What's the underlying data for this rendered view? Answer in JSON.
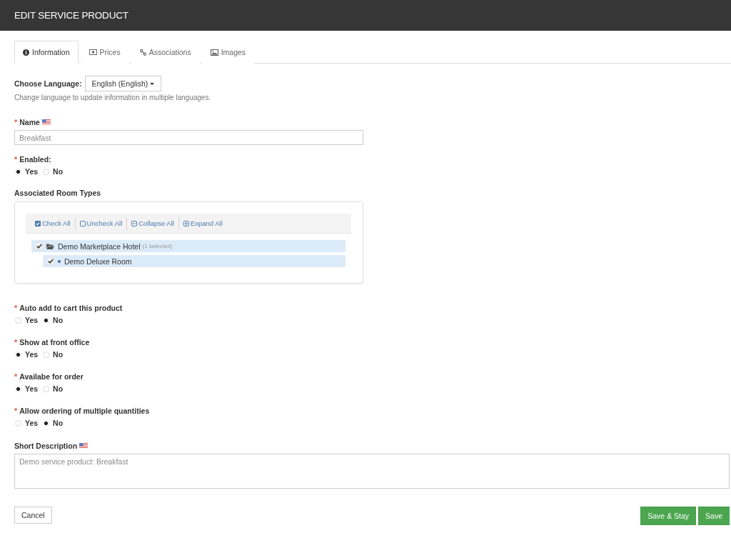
{
  "header": {
    "title": "EDIT SERVICE PRODUCT"
  },
  "tabs": [
    {
      "label": "Information",
      "selected": true
    },
    {
      "label": "Prices",
      "selected": false
    },
    {
      "label": "Associations",
      "selected": false
    },
    {
      "label": "Images",
      "selected": false
    }
  ],
  "language": {
    "label": "Choose Language:",
    "value": "English (English)",
    "help": "Change language to update information in multiple languages."
  },
  "name_field": {
    "required_mark": "*",
    "label": "Name",
    "multilingual": true,
    "value": "Breakfast"
  },
  "enabled": {
    "required_mark": "*",
    "label": "Enabled:",
    "options": [
      {
        "label": "Yes",
        "selected": true
      },
      {
        "label": "No",
        "selected": false
      }
    ]
  },
  "room_types": {
    "label": "Associated Room Types",
    "toolbar": [
      {
        "label": "Check All"
      },
      {
        "label": "Uncheck All"
      },
      {
        "label": "Collapse All"
      },
      {
        "label": "Expand All"
      }
    ],
    "tree": [
      {
        "label": "Demo Marketplace Hotel",
        "note": "(1 selected)",
        "checked": true,
        "expanded": true,
        "children": [
          {
            "label": "Demo Deluxe Room",
            "checked": true
          }
        ]
      }
    ]
  },
  "settings": [
    {
      "required_mark": "*",
      "label": "Auto add to cart this product",
      "options": [
        {
          "label": "Yes",
          "selected": false
        },
        {
          "label": "No",
          "selected": true
        }
      ]
    },
    {
      "required_mark": "*",
      "label": "Show at front office",
      "options": [
        {
          "label": "Yes",
          "selected": true
        },
        {
          "label": "No",
          "selected": false
        }
      ]
    },
    {
      "required_mark": "*",
      "label": "Availabe for order",
      "options": [
        {
          "label": "Yes",
          "selected": true
        },
        {
          "label": "No",
          "selected": false
        }
      ]
    },
    {
      "required_mark": "*",
      "label": "Allow ordering of multiple quantities",
      "options": [
        {
          "label": "Yes",
          "selected": false
        },
        {
          "label": "No",
          "selected": true
        }
      ]
    }
  ],
  "short_description": {
    "label": "Short Description",
    "multilingual": true,
    "value": "Demo service product: Breakfast"
  },
  "buttons": [
    {
      "label": "Cancel",
      "kind": "secondary"
    },
    {
      "label": "Save & Stay",
      "kind": "primary"
    },
    {
      "label": "Save",
      "kind": "primary"
    }
  ]
}
